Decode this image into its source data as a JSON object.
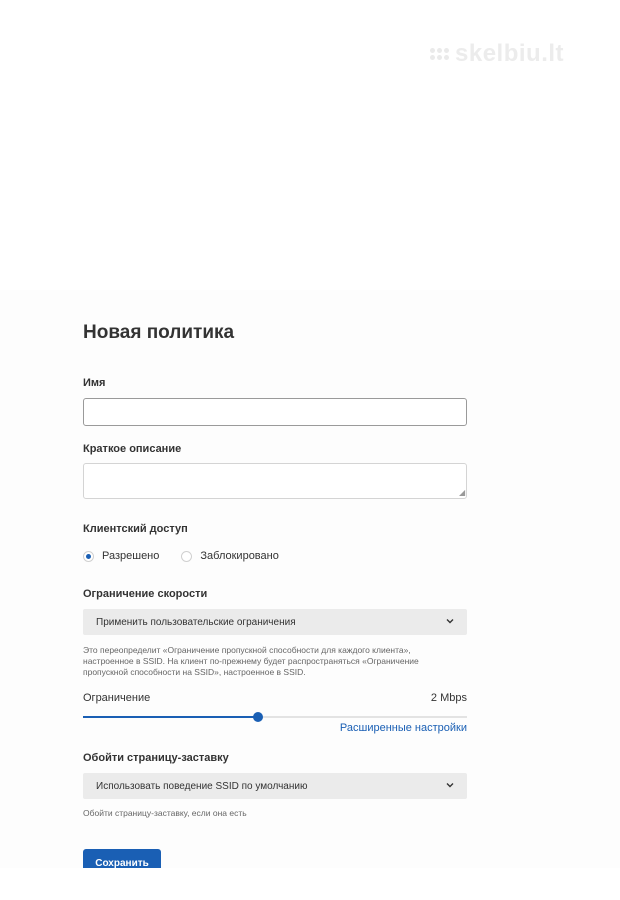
{
  "watermark": {
    "text": "skelbiu.lt"
  },
  "form": {
    "title": "Новая политика",
    "name_label": "Имя",
    "name_value": "",
    "description_label": "Краткое описание",
    "description_value": "",
    "client_access": {
      "label": "Клиентский доступ",
      "options": [
        {
          "label": "Разрешено",
          "checked": true
        },
        {
          "label": "Заблокировано",
          "checked": false
        }
      ]
    },
    "speed_limit": {
      "label": "Ограничение скорости",
      "selected": "Применить пользовательские ограничения",
      "help_lines": [
        "Это переопределит «Ограничение пропускной способности для каждого клиента»,",
        "настроенное в SSID. На клиент по-прежнему будет распространяться «Ограничение",
        "пропускной способности на SSID», настроенное в SSID."
      ],
      "limit_label": "Ограничение",
      "limit_value": "2 Mbps",
      "slider_fraction": 0.455,
      "advanced_link": "Расширенные настройки"
    },
    "splash": {
      "label": "Обойти страницу-заставку",
      "selected": "Использовать поведение SSID по умолчанию",
      "help": "Обойти страницу-заставку, если она есть"
    },
    "save_label": "Сохранить"
  },
  "colors": {
    "accent": "#1a5fb4",
    "select_bg": "#ebebeb"
  }
}
